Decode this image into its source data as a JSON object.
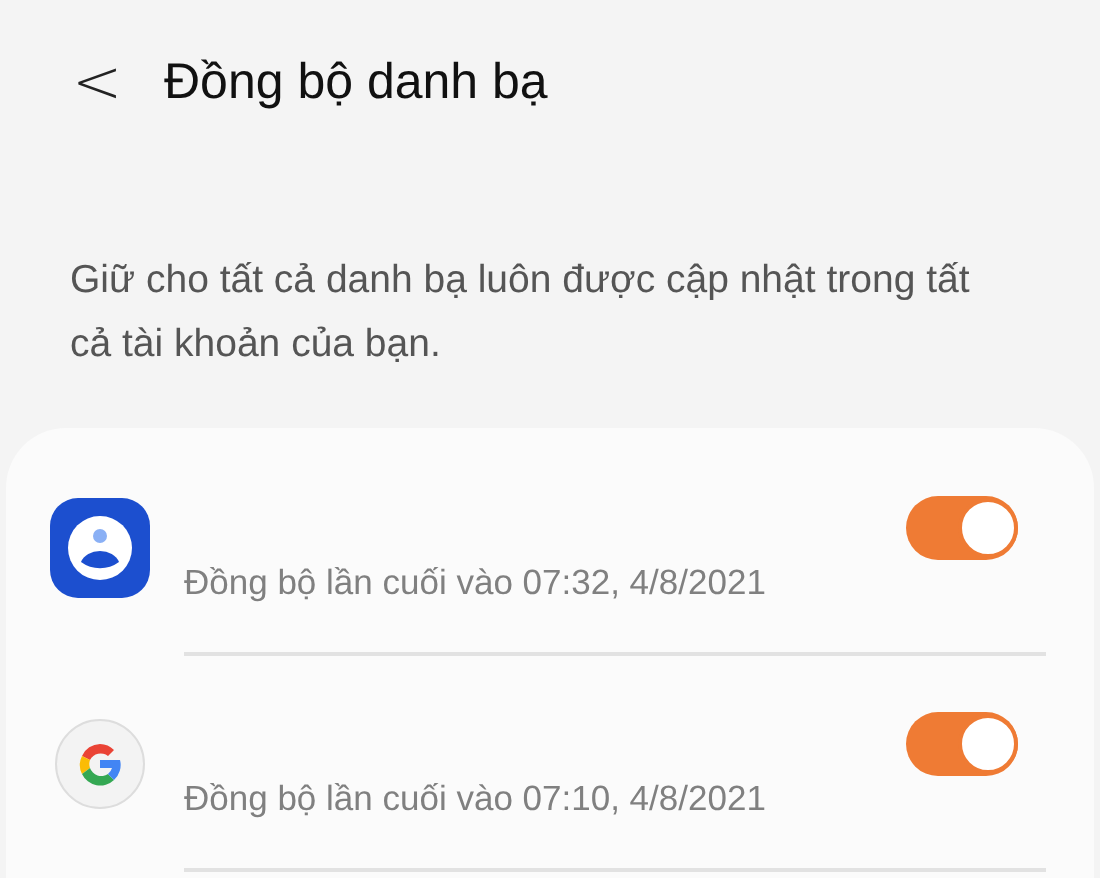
{
  "header": {
    "back": "<",
    "title": "Đồng bộ danh bạ"
  },
  "description": "Giữ cho tất cả danh bạ luôn được cập nhật trong tất cả tài khoản của bạn.",
  "accounts": [
    {
      "kind": "contacts",
      "subtitle": "Đồng bộ lần cuối vào 07:32, 4/8/2021",
      "on": true
    },
    {
      "kind": "google",
      "subtitle": "Đồng bộ lần cuối vào 07:10, 4/8/2021",
      "on": true
    }
  ]
}
